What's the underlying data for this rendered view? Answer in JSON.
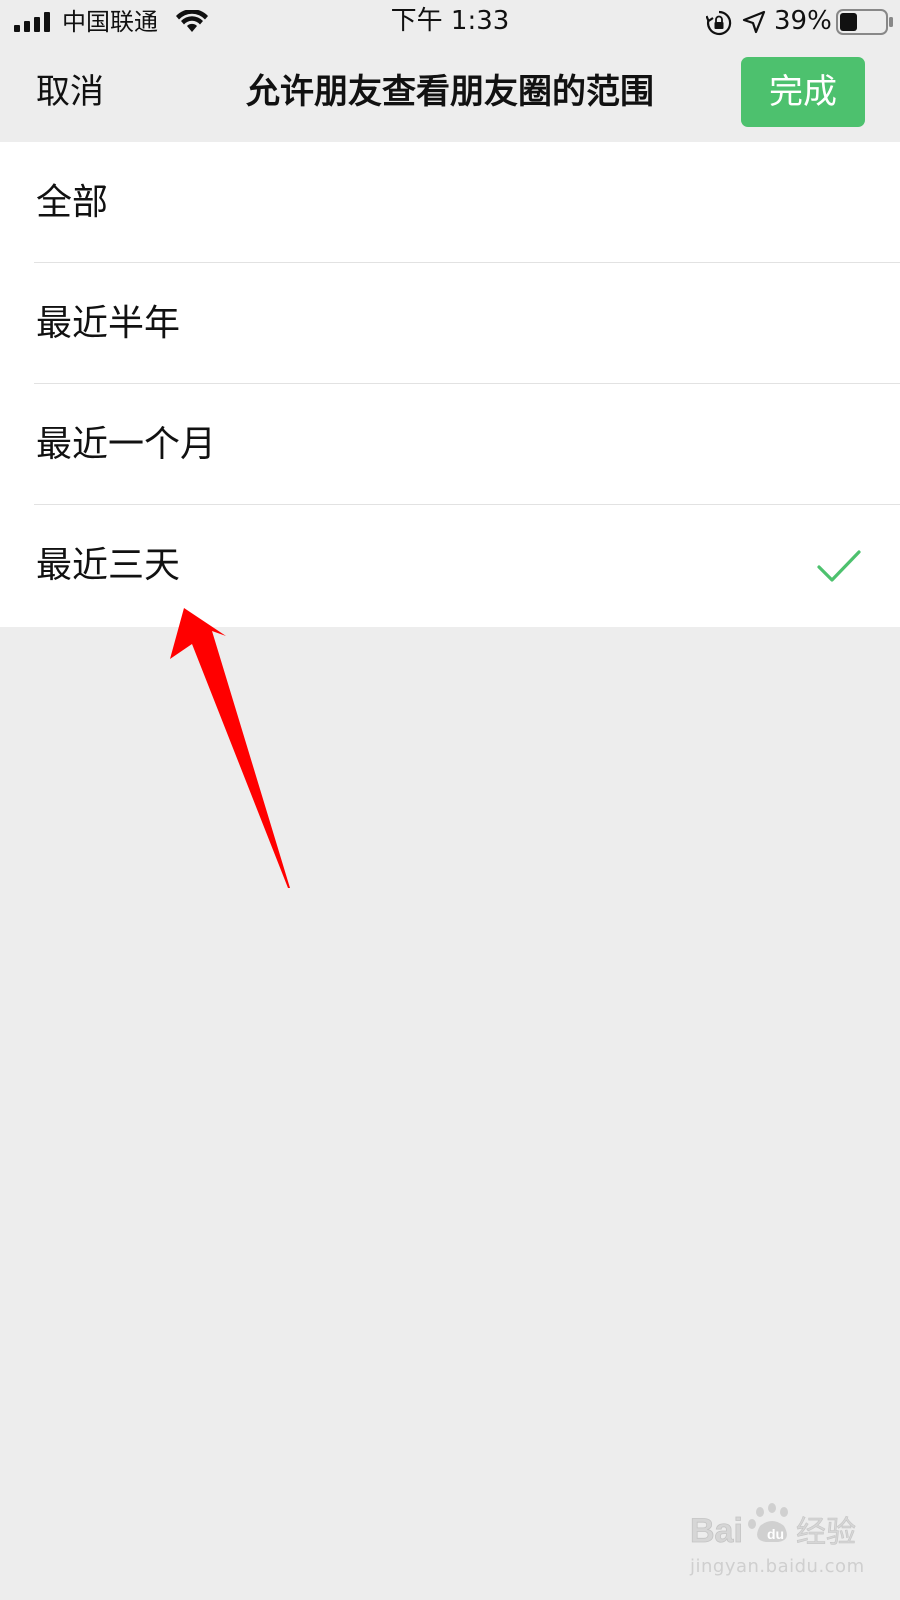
{
  "status_bar": {
    "carrier": "中国联通",
    "time": "下午 1:33",
    "battery": "39%",
    "battery_level": 0.39,
    "icons": [
      "signal-icon",
      "wifi-icon",
      "rotation-lock-icon",
      "location-icon",
      "battery-icon"
    ]
  },
  "nav": {
    "cancel_label": "取消",
    "title": "允许朋友查看朋友圈的范围",
    "done_label": "完成"
  },
  "options": [
    {
      "label": "全部",
      "selected": false
    },
    {
      "label": "最近半年",
      "selected": false
    },
    {
      "label": "最近一个月",
      "selected": false
    },
    {
      "label": "最近三天",
      "selected": true
    }
  ],
  "watermark": {
    "logo_text": "Bai du 经验",
    "url": "jingyan.baidu.com"
  },
  "colors": {
    "accent": "#4dc16e",
    "background": "#ededed",
    "list_background": "#ffffff",
    "check": "#4dc16e",
    "annotation_arrow": "#ff0000"
  }
}
